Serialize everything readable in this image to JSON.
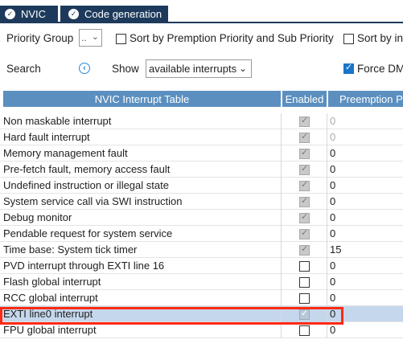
{
  "tabs": [
    {
      "label": "NVIC",
      "icon": "check-circle-icon"
    },
    {
      "label": "Code generation",
      "icon": "check-circle-icon"
    }
  ],
  "controls": {
    "priority_group_label": "Priority Group",
    "priority_group_value": "..",
    "sort_premption_label": "Sort by Premption Priority and Sub Priority",
    "sort_interrupts_label": "Sort by int",
    "search_label": "Search",
    "show_label": "Show",
    "show_value": "available interrupts",
    "force_dma_label": "Force DM"
  },
  "table": {
    "headers": [
      "NVIC Interrupt Table",
      "Enabled",
      "Preemption P"
    ],
    "rows": [
      {
        "name": "Non maskable interrupt",
        "enabled": true,
        "locked": true,
        "preemption": "0",
        "dim": true
      },
      {
        "name": "Hard fault interrupt",
        "enabled": true,
        "locked": true,
        "preemption": "0",
        "dim": true
      },
      {
        "name": "Memory management fault",
        "enabled": true,
        "locked": true,
        "preemption": "0",
        "dim": false
      },
      {
        "name": "Pre-fetch fault, memory access fault",
        "enabled": true,
        "locked": true,
        "preemption": "0",
        "dim": false
      },
      {
        "name": "Undefined instruction or illegal state",
        "enabled": true,
        "locked": true,
        "preemption": "0",
        "dim": false
      },
      {
        "name": "System service call via SWI instruction",
        "enabled": true,
        "locked": true,
        "preemption": "0",
        "dim": false
      },
      {
        "name": "Debug monitor",
        "enabled": true,
        "locked": true,
        "preemption": "0",
        "dim": false
      },
      {
        "name": "Pendable request for system service",
        "enabled": true,
        "locked": true,
        "preemption": "0",
        "dim": false
      },
      {
        "name": "Time base: System tick timer",
        "enabled": true,
        "locked": true,
        "preemption": "15",
        "dim": false
      },
      {
        "name": "PVD interrupt through EXTI line 16",
        "enabled": false,
        "locked": false,
        "preemption": "0",
        "dim": false
      },
      {
        "name": "Flash global interrupt",
        "enabled": false,
        "locked": false,
        "preemption": "0",
        "dim": false
      },
      {
        "name": "RCC global interrupt",
        "enabled": false,
        "locked": false,
        "preemption": "0",
        "dim": false
      },
      {
        "name": "EXTI line0 interrupt",
        "enabled": true,
        "locked": false,
        "preemption": "0",
        "dim": false,
        "selected": true
      },
      {
        "name": "FPU global interrupt",
        "enabled": false,
        "locked": false,
        "preemption": "0",
        "dim": false
      }
    ]
  },
  "colors": {
    "tab_bg": "#1d3a5c",
    "header_bg": "#5b8fbf",
    "selected_row": "#c5d7ec",
    "highlight_border": "#ff2a12"
  }
}
